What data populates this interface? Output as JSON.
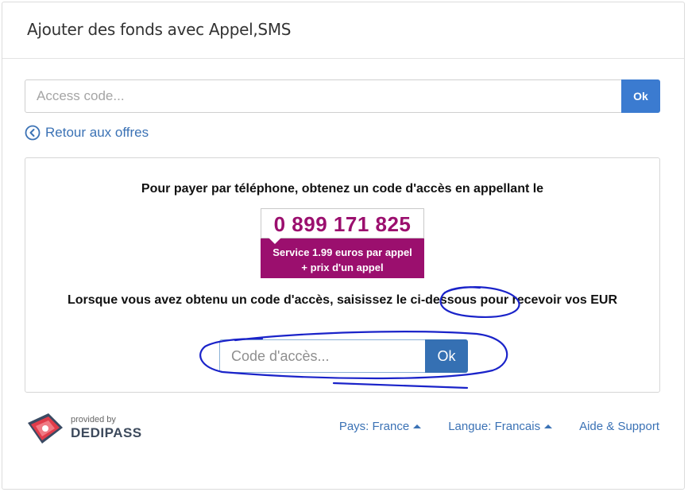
{
  "header": {
    "title": "Ajouter des fonds avec Appel,SMS"
  },
  "access": {
    "placeholder": "Access code...",
    "ok_label": "Ok"
  },
  "back_link": {
    "label": "Retour aux offres"
  },
  "payment": {
    "instruction": "Pour payer par téléphone, obtenez un code d'accès en appellant le",
    "phone_number": "0 899 171 825",
    "service_text": "Service 1.99 euros par appel + prix d'un appel",
    "instruction2": "Lorsque vous avez obtenu un code d'accès, saisissez le ci-dessous pour recevoir vos EUR",
    "code_placeholder": "Code d'accès...",
    "code_ok_label": "Ok"
  },
  "footer": {
    "provided_by": "provided by",
    "brand": "DEDIPASS",
    "country_label": "Pays: France",
    "language_label": "Langue: Francais",
    "help_label": "Aide & Support"
  },
  "colors": {
    "accent_blue": "#3b7bd0",
    "link_blue": "#3b72b5",
    "phone_magenta": "#9b0f6e",
    "annotation_ink": "#1a23c9"
  }
}
